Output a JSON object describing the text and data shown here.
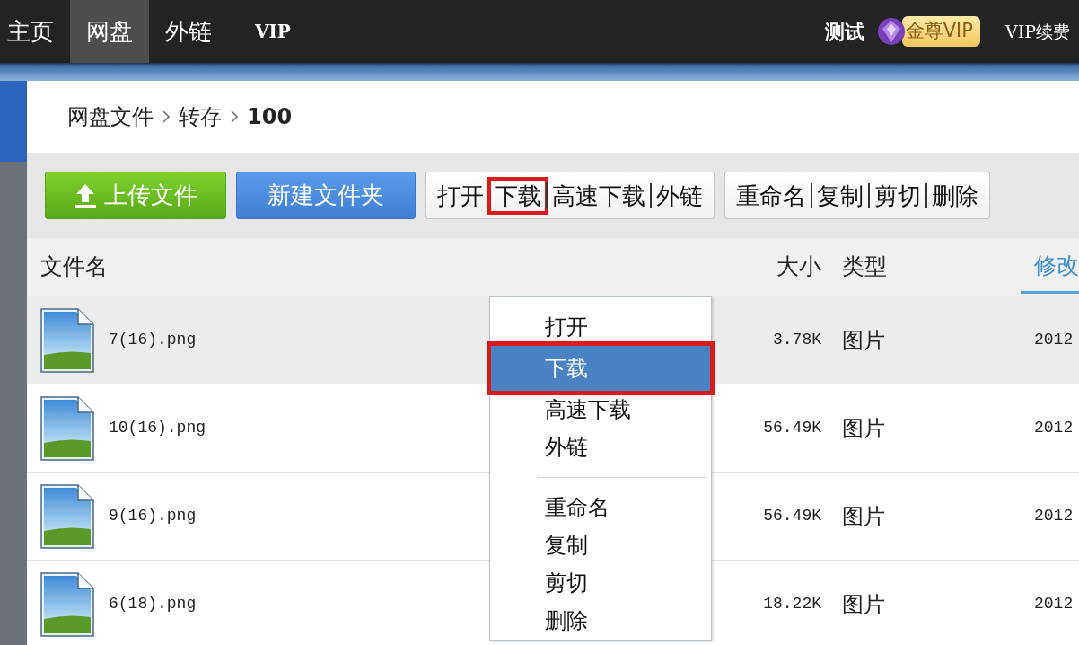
{
  "top_nav": {
    "items": [
      {
        "label": "主页",
        "selected": false
      },
      {
        "label": "网盘",
        "selected": true
      },
      {
        "label": "外链",
        "selected": false
      },
      {
        "label": "VIP",
        "selected": false
      }
    ],
    "user": "测试",
    "vip_badge": "金尊VIP",
    "renew_link": "VIP续费"
  },
  "breadcrumb": [
    {
      "label": "网盘文件",
      "current": false
    },
    {
      "label": "转存",
      "current": false
    },
    {
      "label": "100",
      "current": true
    }
  ],
  "toolbar": {
    "upload_button": "上传文件",
    "new_folder_button": "新建文件夹",
    "groups": [
      [
        {
          "label": "打开",
          "highlighted": false
        },
        {
          "label": "下载",
          "highlighted": true
        },
        {
          "label": "高速下载",
          "highlighted": false
        },
        {
          "label": "外链",
          "highlighted": false
        }
      ],
      [
        {
          "label": "重命名",
          "highlighted": false
        },
        {
          "label": "复制",
          "highlighted": false
        },
        {
          "label": "剪切",
          "highlighted": false
        },
        {
          "label": "删除",
          "highlighted": false
        }
      ]
    ]
  },
  "table": {
    "columns": [
      {
        "label": "文件名",
        "sorted": false
      },
      {
        "label": "大小",
        "sorted": false
      },
      {
        "label": "类型",
        "sorted": false
      },
      {
        "label": "修改",
        "sorted": true
      }
    ],
    "rows": [
      {
        "name": "7(16).png",
        "size": "3.78K",
        "type": "图片",
        "modified": "2012",
        "selected": true
      },
      {
        "name": "10(16).png",
        "size": "56.49K",
        "type": "图片",
        "modified": "2012",
        "selected": false
      },
      {
        "name": "9(16).png",
        "size": "56.49K",
        "type": "图片",
        "modified": "2012",
        "selected": false
      },
      {
        "name": "6(18).png",
        "size": "18.22K",
        "type": "图片",
        "modified": "2012",
        "selected": false
      }
    ]
  },
  "context_menu": {
    "items": [
      {
        "kind": "item",
        "label": "打开",
        "selected": false,
        "highlighted": false
      },
      {
        "kind": "item",
        "label": "下载",
        "selected": true,
        "highlighted": true
      },
      {
        "kind": "item",
        "label": "高速下载",
        "selected": false,
        "highlighted": false
      },
      {
        "kind": "item",
        "label": "外链",
        "selected": false,
        "highlighted": false
      },
      {
        "kind": "separator"
      },
      {
        "kind": "item",
        "label": "重命名",
        "selected": false,
        "highlighted": false
      },
      {
        "kind": "item",
        "label": "复制",
        "selected": false,
        "highlighted": false
      },
      {
        "kind": "item",
        "label": "剪切",
        "selected": false,
        "highlighted": false
      },
      {
        "kind": "item",
        "label": "删除",
        "selected": false,
        "highlighted": false
      }
    ]
  }
}
